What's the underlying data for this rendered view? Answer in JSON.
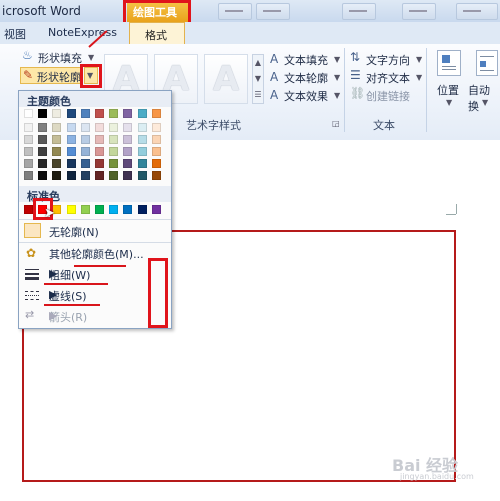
{
  "window": {
    "title": "icrosoft Word"
  },
  "contextual_tab": {
    "header": "绘图工具"
  },
  "tabs": [
    {
      "label": "视图"
    },
    {
      "label": "NoteExpress"
    },
    {
      "label": "格式"
    }
  ],
  "ribbon": {
    "shape_fill": "形状填充",
    "shape_outline": "形状轮廓",
    "text_fill": "文本填充",
    "text_outline": "文本轮廓",
    "text_effects": "文本效果",
    "text_direction": "文字方向",
    "align_text": "对齐文本",
    "create_link": "创建链接",
    "position": "位置",
    "auto_wrap": "自动换",
    "group_wordart": "艺术字样式",
    "group_text": "文本",
    "wordart_glyph": "A"
  },
  "dropdown": {
    "theme_colors_label": "主题颜色",
    "standard_colors_label": "标准色",
    "no_outline": "无轮廓(N)",
    "more_colors": "其他轮廓颜色(M)...",
    "weight": "粗细(W)",
    "dashes": "虚线(S)",
    "arrows": "箭头(R)"
  },
  "colors": {
    "theme_top": [
      "#ffffff",
      "#000000",
      "#eeece1",
      "#1f497d",
      "#4f81bd",
      "#c0504d",
      "#9bbb59",
      "#8064a2",
      "#4bacc6",
      "#f79646"
    ],
    "theme_shades": [
      [
        "#f2f2f2",
        "#7f7f7f",
        "#ddd9c3",
        "#c6d9f0",
        "#dbe5f1",
        "#f2dcdb",
        "#ebf1dd",
        "#e5e0ec",
        "#dbeef3",
        "#fdeada"
      ],
      [
        "#d8d8d8",
        "#595959",
        "#c4bd97",
        "#8db3e2",
        "#b8cce4",
        "#e5b9b7",
        "#d7e3bc",
        "#ccc1d9",
        "#b7dde8",
        "#fbd5b5"
      ],
      [
        "#bfbfbf",
        "#3f3f3f",
        "#938953",
        "#548dd4",
        "#95b3d7",
        "#d99694",
        "#c3d69b",
        "#b2a2c7",
        "#92cddc",
        "#fac08f"
      ],
      [
        "#a5a5a5",
        "#262626",
        "#494429",
        "#17365d",
        "#366092",
        "#953734",
        "#76923c",
        "#5f497a",
        "#31859b",
        "#e36c09"
      ],
      [
        "#7f7f7f",
        "#0c0c0c",
        "#1d1b10",
        "#0f243e",
        "#244061",
        "#632423",
        "#4f6128",
        "#3f3151",
        "#205867",
        "#974806"
      ]
    ],
    "standard": [
      "#c00000",
      "#ff0000",
      "#ffc000",
      "#ffff00",
      "#92d050",
      "#00b050",
      "#00b0f0",
      "#0070c0",
      "#002060",
      "#7030a0"
    ],
    "annotation_red": "#e0141b",
    "shape_outline": "#b51a1a"
  },
  "watermark": {
    "text": "Bai 经验",
    "sub": "jingyan.baidu.com"
  }
}
